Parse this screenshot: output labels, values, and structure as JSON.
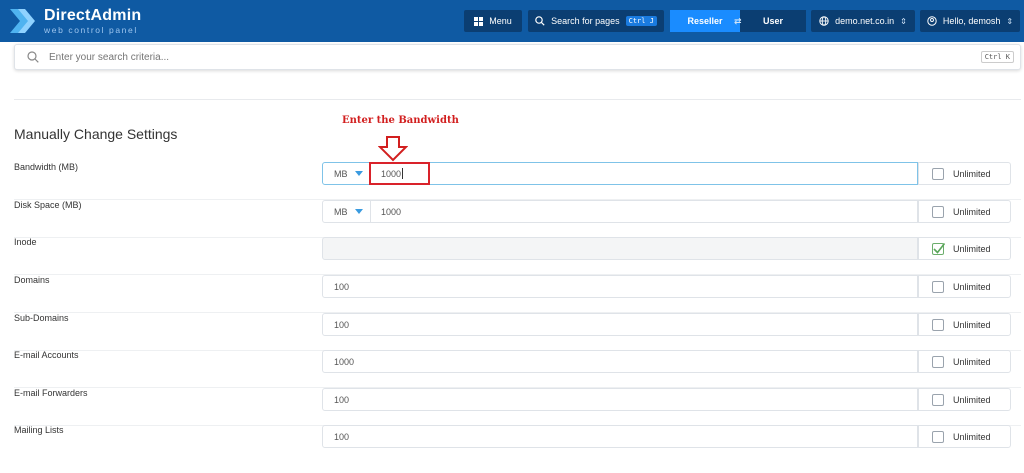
{
  "app": {
    "logo_title": "DirectAdmin",
    "logo_subtitle": "web control panel",
    "brand_color": "#0f5aa3"
  },
  "topnav": {
    "menu_label": "Menu",
    "search_label": "Search for pages",
    "search_shortcut": "Ctrl J",
    "role_active": "Reseller",
    "role_inactive": "User",
    "domain": "demo.net.co.in",
    "greeting": "Hello, demosh"
  },
  "search": {
    "placeholder": "Enter your search criteria...",
    "shortcut": "Ctrl K"
  },
  "page": {
    "section_title": "Manually Change Settings",
    "annotation": "Enter the Bandwidth"
  },
  "rows": [
    {
      "label": "Bandwidth (MB)",
      "unit": "MB",
      "value": "1000",
      "unlimited_label": "Unlimited",
      "unlimited": false
    },
    {
      "label": "Disk Space (MB)",
      "unit": "MB",
      "value": "1000",
      "unlimited_label": "Unlimited",
      "unlimited": false
    },
    {
      "label": "Inode",
      "value": "",
      "unlimited_label": "Unlimited",
      "unlimited": true
    },
    {
      "label": "Domains",
      "value": "100",
      "unlimited_label": "Unlimited",
      "unlimited": false
    },
    {
      "label": "Sub-Domains",
      "value": "100",
      "unlimited_label": "Unlimited",
      "unlimited": false
    },
    {
      "label": "E-mail Accounts",
      "value": "1000",
      "unlimited_label": "Unlimited",
      "unlimited": false
    },
    {
      "label": "E-mail Forwarders",
      "value": "100",
      "unlimited_label": "Unlimited",
      "unlimited": false
    },
    {
      "label": "Mailing Lists",
      "value": "100",
      "unlimited_label": "Unlimited",
      "unlimited": false
    }
  ]
}
